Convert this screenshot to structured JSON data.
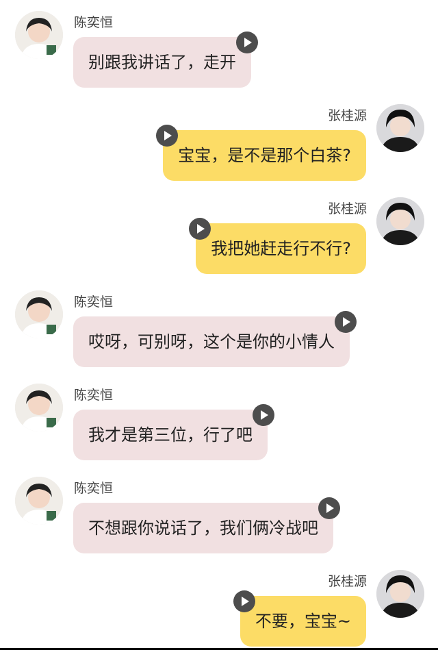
{
  "speakers": {
    "left_name": "陈奕恒",
    "right_name": "张桂源"
  },
  "messages": [
    {
      "side": "left",
      "name": "陈奕恒",
      "text": "别跟我讲话了，走开"
    },
    {
      "side": "right",
      "name": "张桂源",
      "text": "宝宝，是不是那个白茶?"
    },
    {
      "side": "right",
      "name": "张桂源",
      "text": "我把她赶走行不行?"
    },
    {
      "side": "left",
      "name": "陈奕恒",
      "text": "哎呀，可别呀，这个是你的小情人"
    },
    {
      "side": "left",
      "name": "陈奕恒",
      "text": "我才是第三位，行了吧"
    },
    {
      "side": "left",
      "name": "陈奕恒",
      "text": "不想跟你说话了，我们俩冷战吧"
    },
    {
      "side": "right",
      "name": "张桂源",
      "text": "不要，宝宝~"
    }
  ],
  "colors": {
    "left_bubble": "#f1e0e1",
    "right_bubble": "#fcdc66",
    "play_button": "#4d4d4d"
  },
  "icons": {
    "voice_play": "play-icon",
    "left_avatar": "avatar-chen",
    "right_avatar": "avatar-zhang"
  }
}
